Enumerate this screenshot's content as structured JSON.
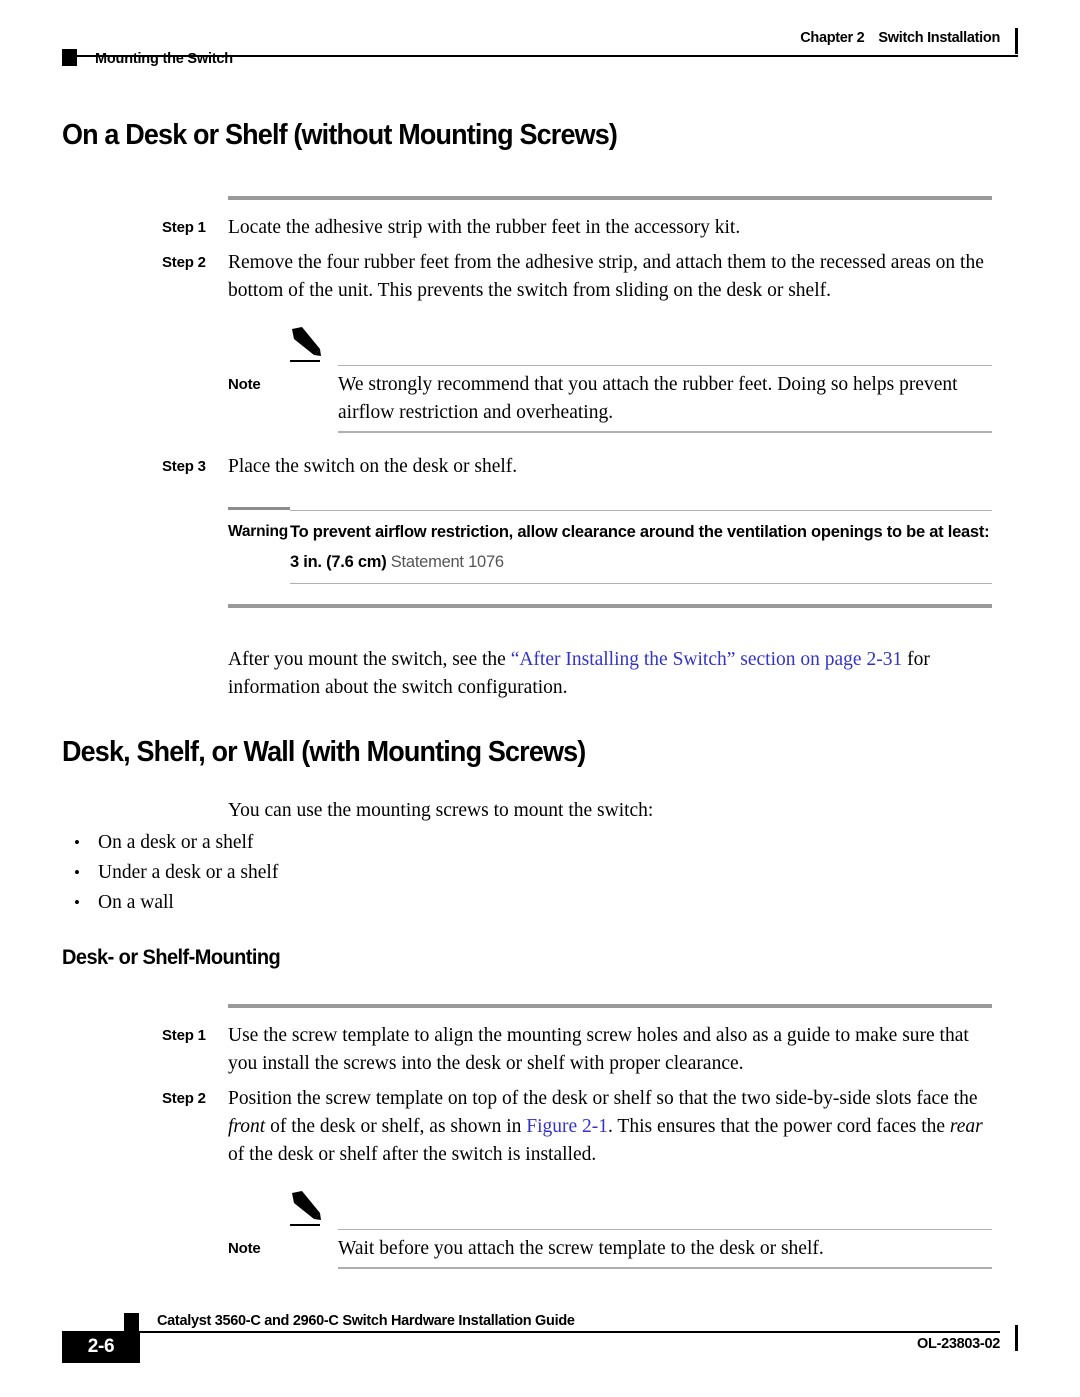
{
  "header": {
    "chapter_label": "Chapter 2",
    "chapter_title": "Switch Installation",
    "section_name": "Mounting the Switch"
  },
  "sections": {
    "desk_no_screws": {
      "title": "On a Desk or Shelf (without Mounting Screws)",
      "step1_label": "Step 1",
      "step1_text": "Locate the adhesive strip with the rubber feet in the accessory kit.",
      "step2_label": "Step 2",
      "step2_text": "Remove the four rubber feet from the adhesive strip, and attach them to the recessed areas on the bottom of the unit. This prevents the switch from sliding on the desk or shelf.",
      "note_label": "Note",
      "note_text": "We strongly recommend that you attach the rubber feet. Doing so helps prevent airflow restriction and overheating.",
      "step3_label": "Step 3",
      "step3_text": "Place the switch on the desk or shelf.",
      "warning_label": "Warning",
      "warning_text": "To prevent airflow restriction, allow clearance around the ventilation openings to be at least: 3 in. (7.6 cm)",
      "warning_statement": "Statement 1076",
      "after_text_before": "After you mount the switch, see the ",
      "after_link": "“After Installing the Switch” section on page 2-31",
      "after_text_after": " for information about the switch configuration."
    },
    "desk_with_screws": {
      "title": "Desk, Shelf, or Wall (with Mounting Screws)",
      "intro": "You can use the mounting screws to mount the switch:",
      "bullets": [
        "On a desk or a shelf",
        "Under a desk or a shelf",
        "On a wall"
      ],
      "subsection_title": "Desk- or Shelf-Mounting",
      "step1_label": "Step 1",
      "step1_text": "Use the screw template to align the mounting screw holes and also as a guide to make sure that you install the screws into the desk or shelf with proper clearance.",
      "step2_label": "Step 2",
      "step2_part1": "Position the screw template on top of the desk or shelf so that the two side-by-side slots face the ",
      "step2_italic1": "front",
      "step2_part2": " of the desk or shelf, as shown in ",
      "step2_link": "Figure 2-1",
      "step2_part3": ". This ensures that the power cord faces the ",
      "step2_italic2": "rear",
      "step2_part4": " of the desk or shelf after the switch is installed.",
      "note_label": "Note",
      "note_text": "Wait before you attach the screw template to the desk or shelf."
    }
  },
  "footer": {
    "guide_title": "Catalyst 3560-C and 2960-C Switch Hardware Installation Guide",
    "page_number": "2-6",
    "doc_id": "OL-23803-02"
  },
  "colors": {
    "link": "#3333cc",
    "rule_thick": "#9a9a9a",
    "rule_thin": "#b0b0b0"
  }
}
